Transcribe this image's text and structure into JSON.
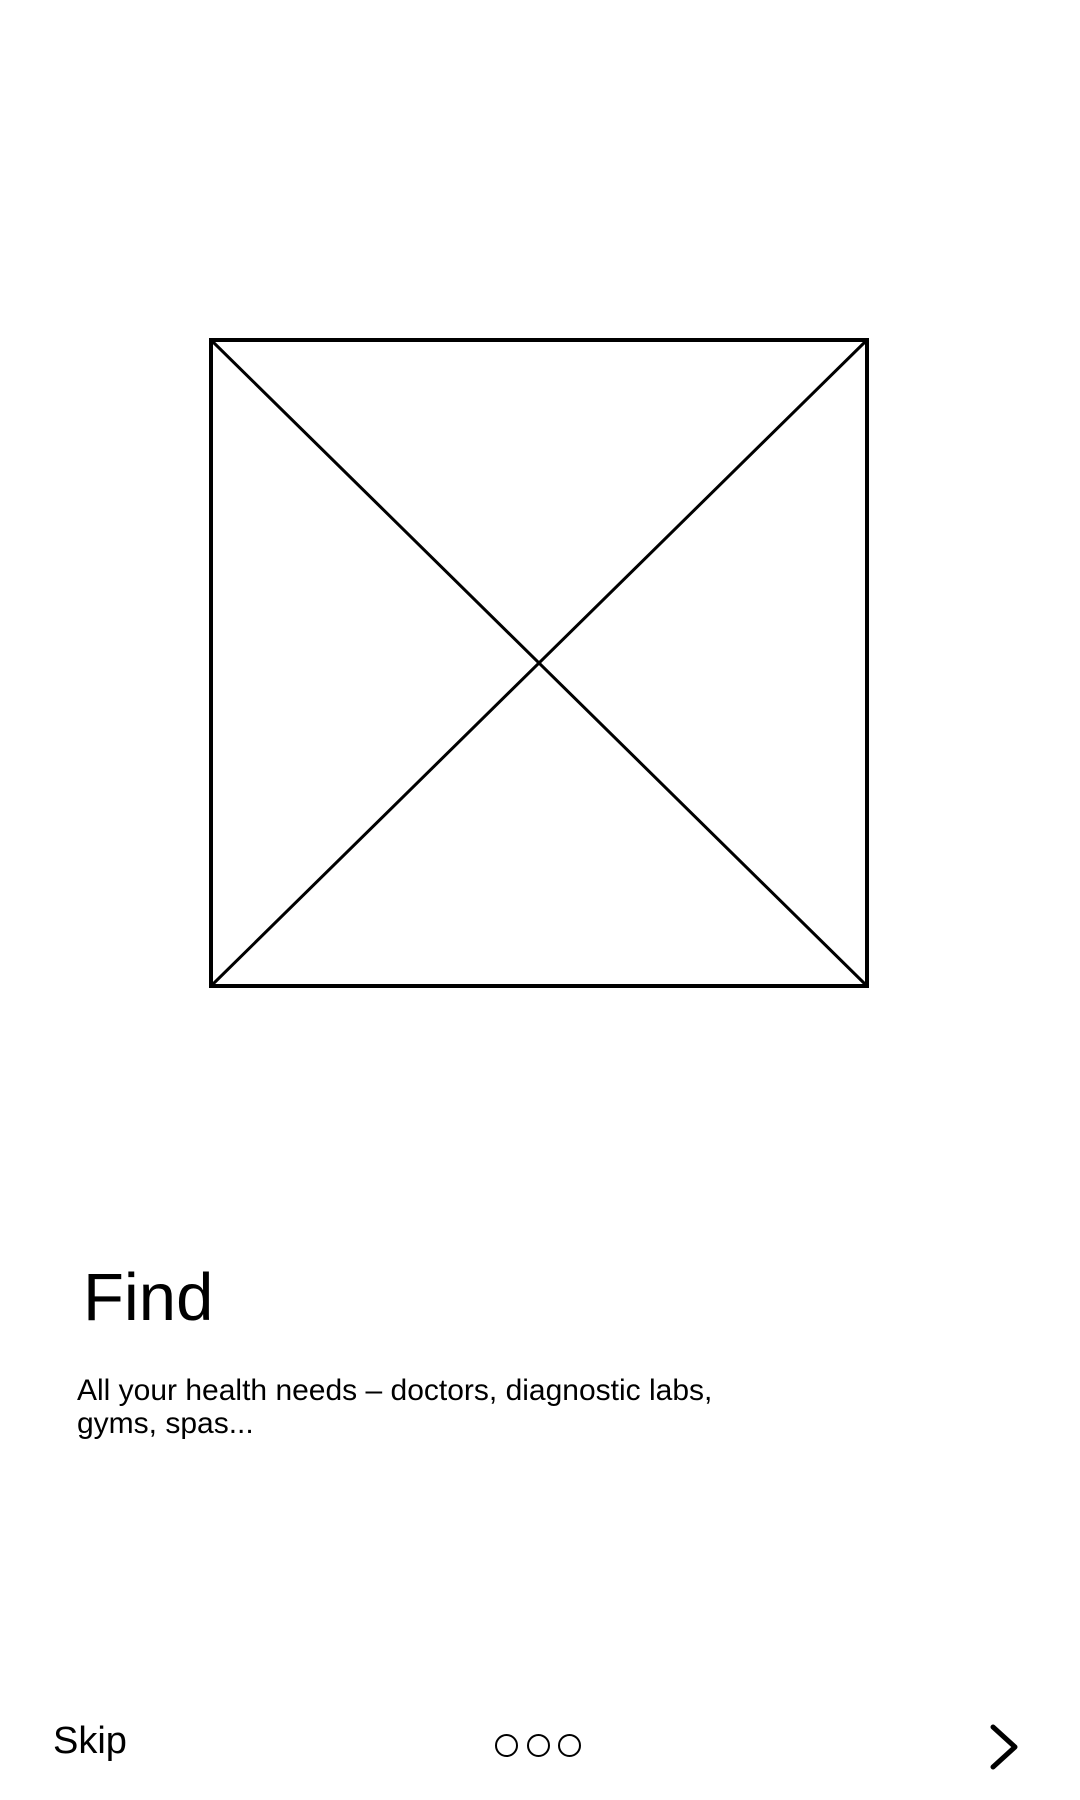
{
  "onboarding": {
    "title": "Find",
    "description": "All your health needs – doctors, diagnostic labs, gyms, spas...",
    "image_placeholder": "image-placeholder-icon"
  },
  "footer": {
    "skip_label": "Skip",
    "page_indicator": {
      "total_pages": 3
    },
    "next_icon": "chevron-right-icon"
  }
}
